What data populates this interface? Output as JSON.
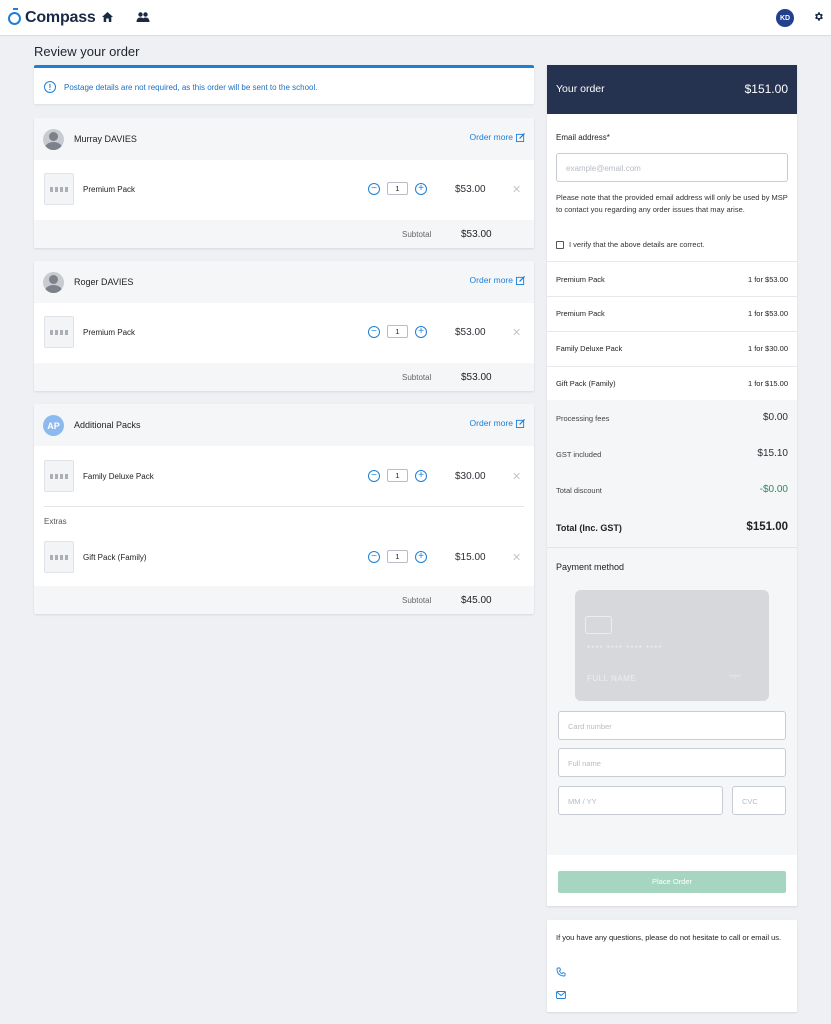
{
  "app": {
    "name": "Compass",
    "user_initials": "KD"
  },
  "page": {
    "title": "Review your order"
  },
  "notice": {
    "text": "Postage details are not required, as this order will be sent to the school."
  },
  "groups": [
    {
      "name": "Murray DAVIES",
      "order_more": "Order more",
      "items": [
        {
          "name": "Premium Pack",
          "qty": "1",
          "price": "$53.00"
        }
      ],
      "subtotal_label": "Subtotal",
      "subtotal": "$53.00"
    },
    {
      "name": "Roger DAVIES",
      "order_more": "Order more",
      "items": [
        {
          "name": "Premium Pack",
          "qty": "1",
          "price": "$53.00"
        }
      ],
      "subtotal_label": "Subtotal",
      "subtotal": "$53.00"
    },
    {
      "avatar": "AP",
      "name": "Additional Packs",
      "order_more": "Order more",
      "items": [
        {
          "name": "Family Deluxe Pack",
          "qty": "1",
          "price": "$30.00"
        }
      ],
      "extras_label": "Extras",
      "extras": [
        {
          "name": "Gift Pack (Family)",
          "qty": "1",
          "price": "$15.00"
        }
      ],
      "subtotal_label": "Subtotal",
      "subtotal": "$45.00"
    }
  ],
  "summary": {
    "title": "Your order",
    "total": "$151.00",
    "email_label": "Email address*",
    "email_placeholder": "example@email.com",
    "email_note": "Please note that the provided email address will only be used by MSP to contact you regarding any order issues that may arise.",
    "verify_label": "I verify that the above details are correct.",
    "lines": [
      {
        "name": "Premium Pack",
        "detail": "1 for $53.00"
      },
      {
        "name": "Premium Pack",
        "detail": "1 for $53.00"
      },
      {
        "name": "Family Deluxe Pack",
        "detail": "1 for $30.00"
      },
      {
        "name": "Gift Pack (Family)",
        "detail": "1 for $15.00"
      }
    ],
    "fees": [
      {
        "label": "Processing fees",
        "value": "$0.00"
      },
      {
        "label": "GST included",
        "value": "$15.10"
      },
      {
        "label": "Total discount",
        "value": "-$0.00"
      }
    ],
    "total_label": "Total (Inc. GST)",
    "total_value": "$151.00"
  },
  "payment": {
    "title": "Payment method",
    "card_number_mask": "**** **** **** ****",
    "card_name_mask": "FULL NAME",
    "card_exp_mask": "**/**",
    "card_number_placeholder": "Card number",
    "full_name_placeholder": "Full name",
    "expiry_placeholder": "MM / YY",
    "cvc_placeholder": "CVC",
    "place_order": "Place Order"
  },
  "contact": {
    "text": "If you have any questions, please do not hesitate to call or email us."
  },
  "colors": {
    "accent": "#1e7fd6",
    "header_dark": "#253250",
    "discount_green": "#2e8a5a",
    "button_disabled": "#a6d6c2"
  }
}
